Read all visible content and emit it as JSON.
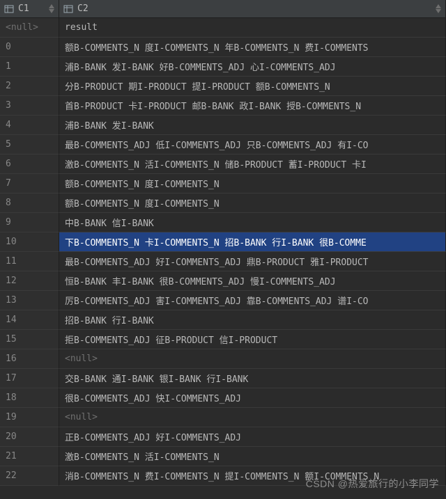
{
  "columns": {
    "c1": {
      "label": "C1"
    },
    "c2": {
      "label": "C2"
    }
  },
  "null_text": "<null>",
  "header_row": {
    "c1": "<null>",
    "c2": "result"
  },
  "selected_index": 10,
  "rows": [
    {
      "idx": "0",
      "val": "额B-COMMENTS_N 度I-COMMENTS_N 年B-COMMENTS_N 费I-COMMENTS"
    },
    {
      "idx": "1",
      "val": "浦B-BANK 发I-BANK 好B-COMMENTS_ADJ 心I-COMMENTS_ADJ"
    },
    {
      "idx": "2",
      "val": "分B-PRODUCT 期I-PRODUCT 提I-PRODUCT 额B-COMMENTS_N"
    },
    {
      "idx": "3",
      "val": "首B-PRODUCT 卡I-PRODUCT 邮B-BANK 政I-BANK 授B-COMMENTS_N"
    },
    {
      "idx": "4",
      "val": "浦B-BANK 发I-BANK"
    },
    {
      "idx": "5",
      "val": "最B-COMMENTS_ADJ 低I-COMMENTS_ADJ 只B-COMMENTS_ADJ 有I-CO"
    },
    {
      "idx": "6",
      "val": "激B-COMMENTS_N 活I-COMMENTS_N 储B-PRODUCT 蓄I-PRODUCT 卡I"
    },
    {
      "idx": "7",
      "val": "额B-COMMENTS_N 度I-COMMENTS_N"
    },
    {
      "idx": "8",
      "val": "额B-COMMENTS_N 度I-COMMENTS_N"
    },
    {
      "idx": "9",
      "val": "中B-BANK 信I-BANK"
    },
    {
      "idx": "10",
      "val": "下B-COMMENTS_N 卡I-COMMENTS_N 招B-BANK 行I-BANK 很B-COMME"
    },
    {
      "idx": "11",
      "val": "最B-COMMENTS_ADJ 好I-COMMENTS_ADJ 鼎B-PRODUCT 雅I-PRODUCT"
    },
    {
      "idx": "12",
      "val": "恒B-BANK 丰I-BANK 很B-COMMENTS_ADJ 慢I-COMMENTS_ADJ"
    },
    {
      "idx": "13",
      "val": "厉B-COMMENTS_ADJ 害I-COMMENTS_ADJ 靠B-COMMENTS_ADJ 谱I-CO"
    },
    {
      "idx": "14",
      "val": "招B-BANK 行I-BANK"
    },
    {
      "idx": "15",
      "val": "拒B-COMMENTS_ADJ 征B-PRODUCT 信I-PRODUCT"
    },
    {
      "idx": "16",
      "val": null
    },
    {
      "idx": "17",
      "val": "交B-BANK 通I-BANK 银I-BANK 行I-BANK"
    },
    {
      "idx": "18",
      "val": "很B-COMMENTS_ADJ 快I-COMMENTS_ADJ"
    },
    {
      "idx": "19",
      "val": null
    },
    {
      "idx": "20",
      "val": "正B-COMMENTS_ADJ 好I-COMMENTS_ADJ"
    },
    {
      "idx": "21",
      "val": "激B-COMMENTS_N 活I-COMMENTS_N"
    },
    {
      "idx": "22",
      "val": "消B-COMMENTS_N 费I-COMMENTS_N 提I-COMMENTS_N 额I-COMMENTS_N"
    }
  ],
  "watermark": "CSDN @热爱旅行的小李同学"
}
